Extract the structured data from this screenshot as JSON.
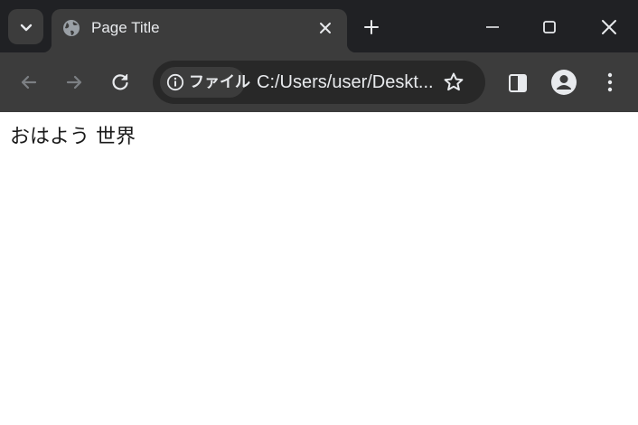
{
  "tab": {
    "title": "Page Title",
    "favicon": "globe-icon"
  },
  "toolbar": {
    "site_info_label": "ファイル",
    "url": "C:/Users/user/Deskt..."
  },
  "page": {
    "text": "おはよう 世界"
  },
  "icons": {
    "tab_search": "chevron-down-icon",
    "tab_close": "close-icon",
    "new_tab": "plus-icon",
    "minimize": "minimize-icon",
    "maximize": "maximize-icon",
    "window_close": "close-icon",
    "back": "arrow-left-icon",
    "forward": "arrow-right-icon",
    "reload": "reload-icon",
    "site_info": "info-icon",
    "bookmark": "star-icon",
    "side_panel": "side-panel-icon",
    "profile": "profile-icon",
    "menu": "more-vert-icon"
  },
  "colors": {
    "tabstrip": "#202124",
    "toolbar": "#3c3c3c",
    "omnibox": "#282828",
    "text": "#e8eaed",
    "page_background": "#ffffff"
  }
}
